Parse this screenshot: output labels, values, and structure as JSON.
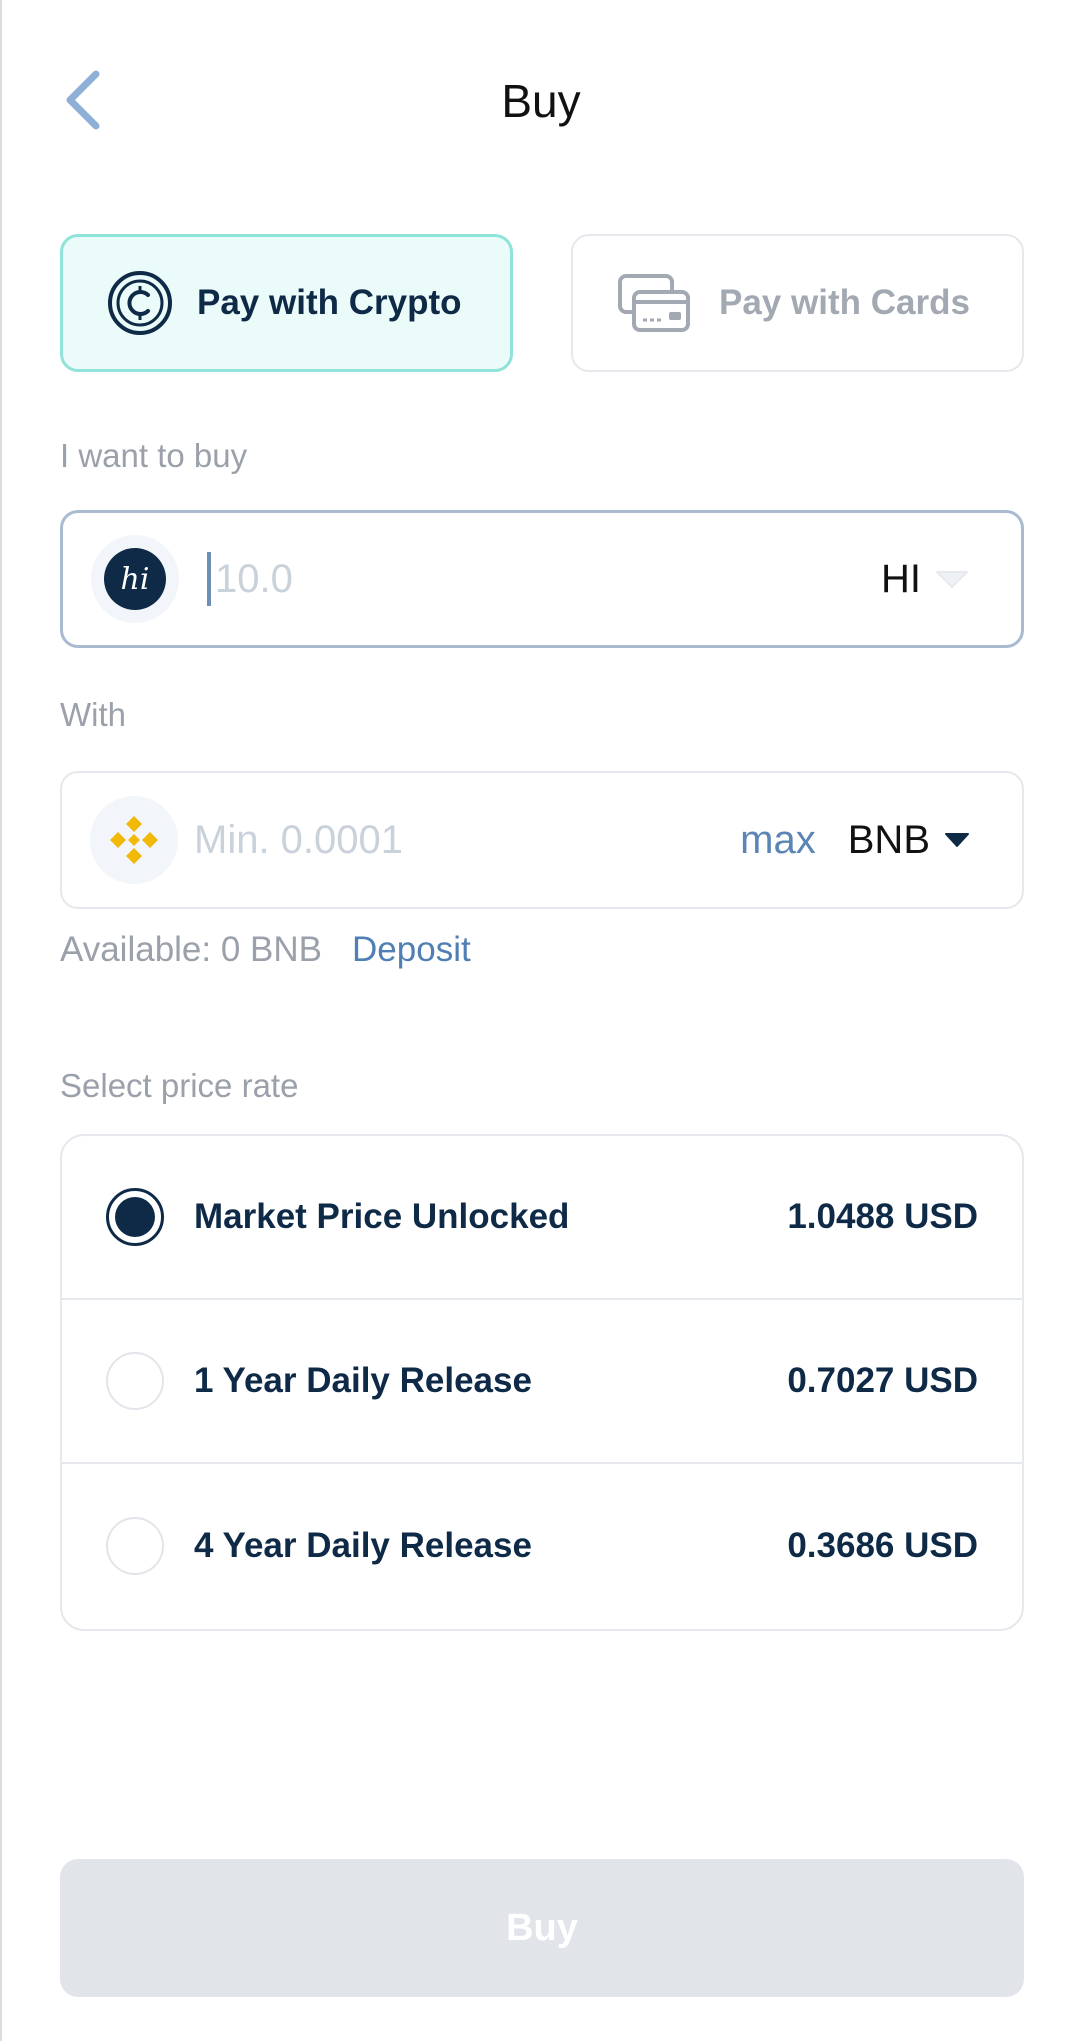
{
  "header": {
    "title": "Buy",
    "back_icon": "chevron-left-icon"
  },
  "payment_methods": {
    "crypto": {
      "label": "Pay with Crypto",
      "icon": "crypto-coin-icon",
      "selected": true
    },
    "cards": {
      "label": "Pay with Cards",
      "icon": "credit-cards-icon",
      "selected": false
    }
  },
  "buy_section": {
    "label": "I want to buy",
    "placeholder": "10.0",
    "value": "",
    "token_symbol": "HI",
    "token_logo_text": "hi"
  },
  "with_section": {
    "label": "With",
    "placeholder": "Min. 0.0001",
    "value": "",
    "max_label": "max",
    "token_symbol": "BNB"
  },
  "available": {
    "text": "Available: 0 BNB",
    "deposit_label": "Deposit"
  },
  "price_rate": {
    "label": "Select price rate",
    "options": [
      {
        "name": "Market Price Unlocked",
        "price": "1.0488 USD",
        "selected": true
      },
      {
        "name": "1 Year Daily Release",
        "price": "0.7027 USD",
        "selected": false
      },
      {
        "name": "4 Year Daily Release",
        "price": "0.3686 USD",
        "selected": false
      }
    ]
  },
  "buy_button": {
    "label": "Buy",
    "enabled": false
  },
  "colors": {
    "primary": "#0e2a47",
    "accent_blue": "#5b85b4",
    "selected_tab_bg": "#ebfbfa",
    "selected_tab_border": "#8fe3d8",
    "muted_text": "#9aa1aa",
    "disabled_button": "#e1e5ea",
    "bnb_yellow": "#f0b90b"
  }
}
